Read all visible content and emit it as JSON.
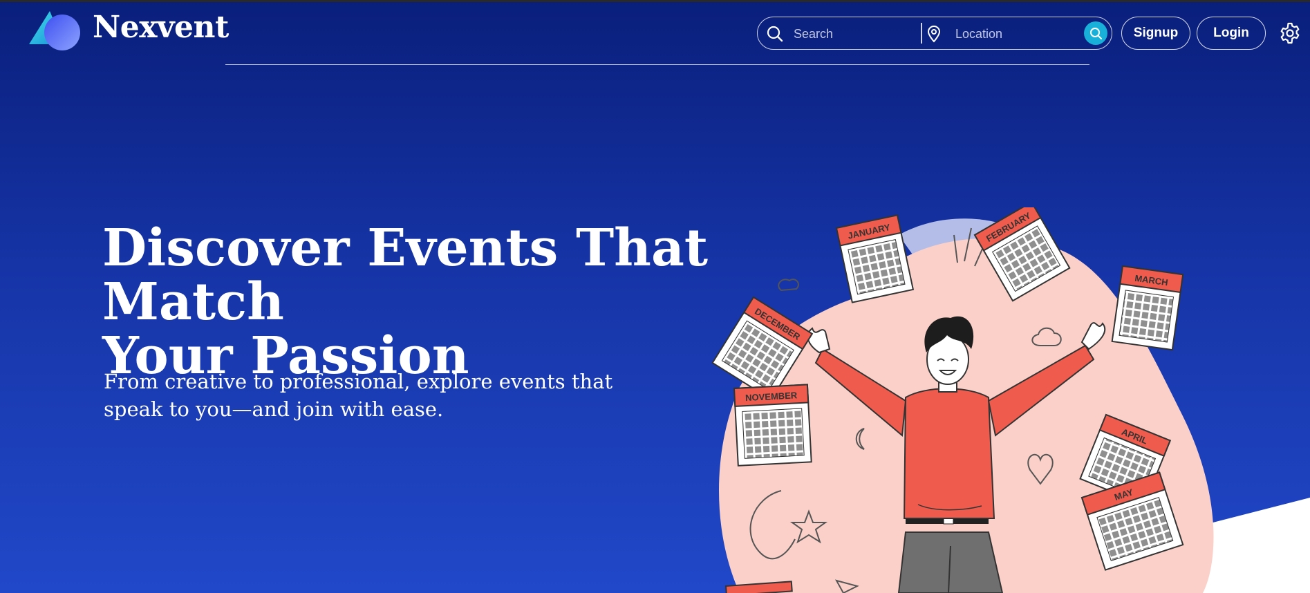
{
  "brand": {
    "name": "Nexvent",
    "logo_icon": "nexvent-logo-icon"
  },
  "header": {
    "search": {
      "placeholder": "Search",
      "icon": "search-icon"
    },
    "location": {
      "placeholder": "Location",
      "icon": "location-pin-icon"
    },
    "search_button_icon": "search-icon",
    "signup_label": "Signup",
    "login_label": "Login",
    "settings_icon": "gear-icon"
  },
  "hero": {
    "title_line1": "Discover Events That Match",
    "title_line2": "Your Passion",
    "subtitle_line1": "From creative to professional, explore events that",
    "subtitle_line2": "speak to you—and join with ease."
  },
  "illustration": {
    "months": [
      "JANUARY",
      "FEBRUARY",
      "MARCH",
      "APRIL",
      "MAY",
      "DECEMBER",
      "NOVEMBER"
    ]
  },
  "colors": {
    "background_top": "#0a1f7c",
    "background_bottom": "#2148c9",
    "accent": "#18b0d9",
    "calendar_red": "#ef5b4c",
    "blob_pink": "#fbd0c8"
  }
}
